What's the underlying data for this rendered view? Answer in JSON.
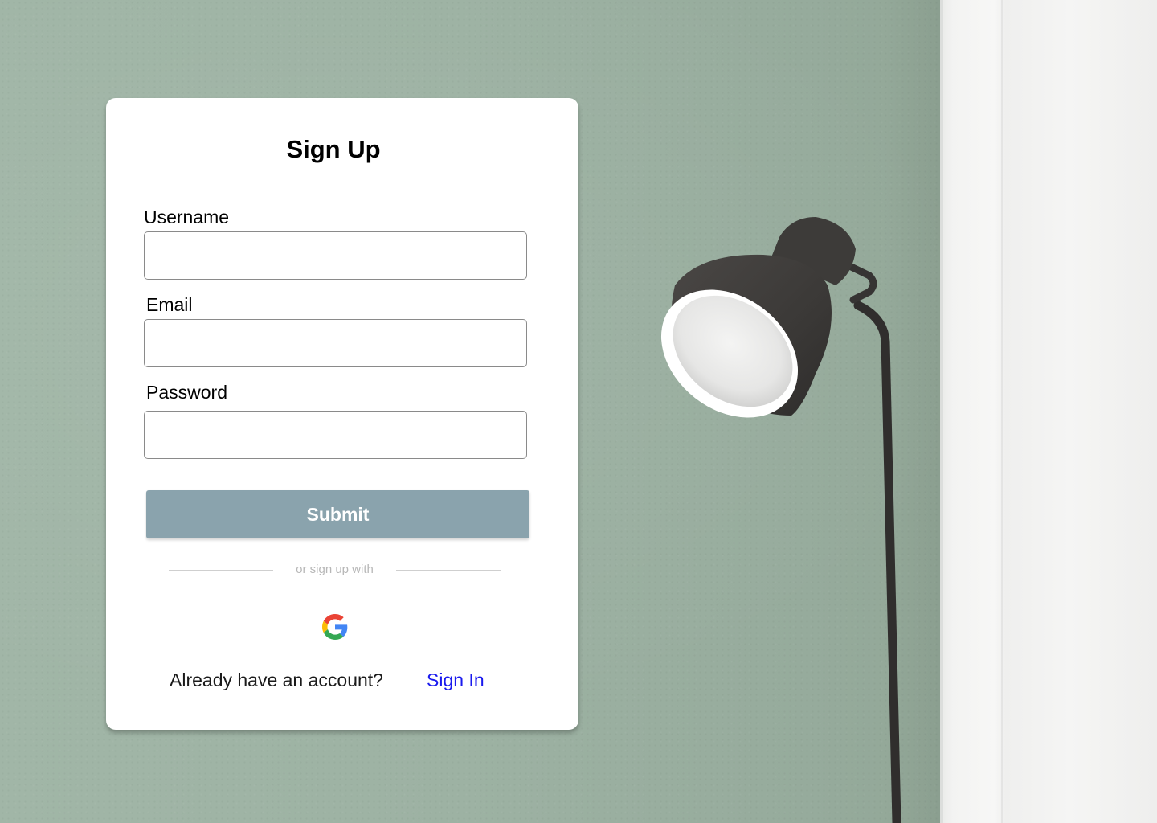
{
  "form": {
    "title": "Sign Up",
    "fields": [
      {
        "label": "Username",
        "value": "",
        "placeholder": ""
      },
      {
        "label": "Email",
        "value": "",
        "placeholder": ""
      },
      {
        "label": "Password",
        "value": "",
        "placeholder": ""
      }
    ],
    "submit_label": "Submit",
    "divider_text": "or sign up with",
    "social_icon": "google-icon",
    "footer": {
      "prompt": "Already have an account?",
      "link_label": "Sign In"
    }
  },
  "colors": {
    "submit_button": "#8aa3ad",
    "link": "#1a1aee",
    "wall": "#9db2a3",
    "card": "#ffffff"
  }
}
